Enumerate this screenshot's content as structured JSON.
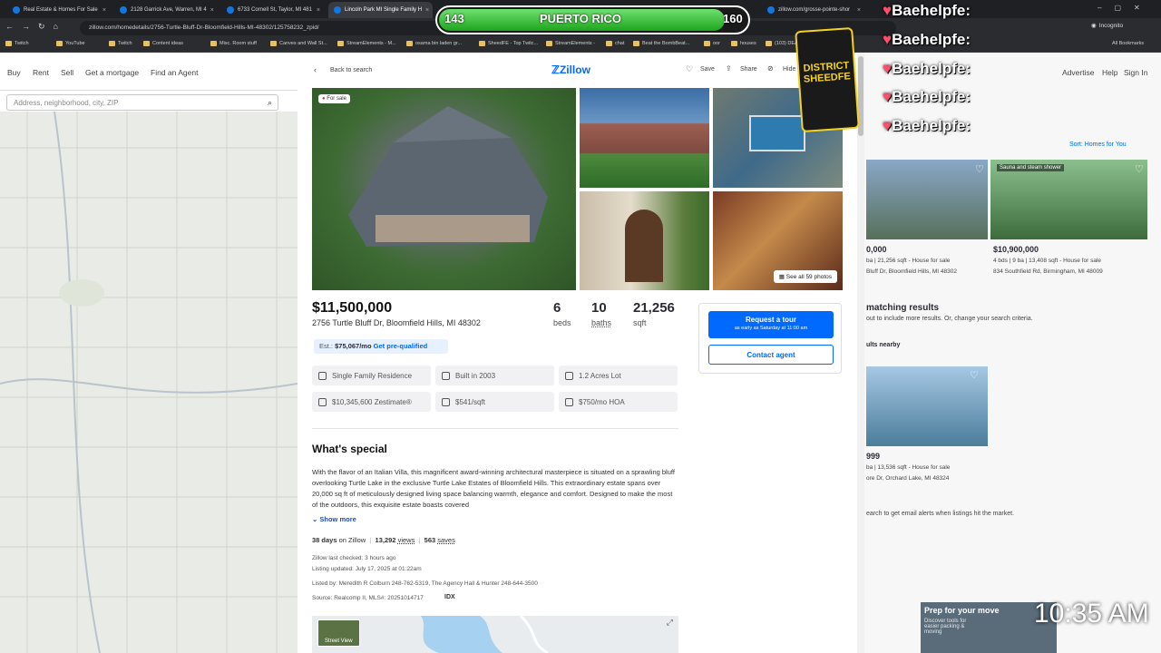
{
  "browser": {
    "tabs": [
      {
        "label": "Real Estate & Homes For Sale",
        "active": false
      },
      {
        "label": "2128 Garrick Ave, Warren, MI 4",
        "active": false
      },
      {
        "label": "6733 Cornell St, Taylor, MI 481",
        "active": false
      },
      {
        "label": "Lincoln Park MI Single Family H",
        "active": false
      },
      {
        "label": "zillow.com/grosse-pointe-shor",
        "active": false
      }
    ],
    "url": "zillow.com/homedetails/2756-Turtle-Bluff-Dr-Bloomfield-Hills-MI-48302/125758232_zpid/",
    "incognito": "Incognito",
    "bookmarks": [
      "Twitch",
      "YouTube",
      "Twitch",
      "Content ideas",
      "Misc. Room stuff",
      "Canves and Wall St...",
      "StreamElements - M...",
      "osama bin laden gr...",
      "SheedFE - Top Twitc...",
      "StreamElements -",
      "chat",
      "Beat the BombBeat...",
      "oor",
      "houses",
      "(103) DEA"
    ],
    "all_bookmarks": "All Bookmarks"
  },
  "zillow_nav": {
    "items": [
      "Buy",
      "Rent",
      "Sell",
      "Get a mortgage",
      "Find an Agent"
    ],
    "right_items": [
      "Advertise",
      "Help",
      "Sign In"
    ],
    "search_placeholder": "Address, neighborhood, city, ZIP"
  },
  "listing": {
    "back_label": "Back to search",
    "brand": "Zillow",
    "save_label": "Save",
    "share_label": "Share",
    "hide_label": "Hide",
    "for_sale_badge": "For sale",
    "see_all_photos": "See all 59 photos",
    "price": "$11,500,000",
    "address": "2756 Turtle Bluff Dr, Bloomfield Hills, MI 48302",
    "beds": "6",
    "beds_label": "beds",
    "baths": "10",
    "baths_label": "baths",
    "sqft": "21,256",
    "sqft_label": "sqft",
    "est_prefix": "Est.:",
    "est_value": "$75,067/mo",
    "prequal": "Get pre-qualified",
    "facts": [
      "Single Family Residence",
      "Built in 2003",
      "1.2 Acres Lot",
      "$10,345,600 Zestimate®",
      "$541/sqft",
      "$750/mo HOA"
    ],
    "tour_label": "Request a tour",
    "tour_sub": "as early as Saturday at 11:00 am",
    "contact_label": "Contact agent",
    "special_heading": "What's special",
    "description": "With the flavor of an Italian Villa, this magnificent award-winning architectural masterpiece is situated on a sprawling bluff overlooking Turtle Lake in the exclusive Turtle Lake Estates of Bloomfield Hills. This extraordinary estate spans over 20,000 sq ft of meticulously designed living space balancing warmth, elegance and comfort. Designed to make the most of the outdoors, this exquisite estate boasts covered",
    "show_more": "Show more",
    "days": "38 days",
    "days_suffix": "on Zillow",
    "views": "13,292",
    "views_label": "views",
    "saves": "563",
    "saves_label": "saves",
    "last_checked": "Zillow last checked: 3 hours ago",
    "updated": "Listing updated: July 17, 2025 at 01:22am",
    "listed_by": "Listed by: Meredith R Colburn 248-762-5319, The Agency Hall & Hunter 248-644-3500",
    "source": "Source: Realcomp II, MLS#: 20251014717",
    "idx": "IDX",
    "street_view": "Street View"
  },
  "right_panel": {
    "sort": "Sort: Homes for You",
    "card1_price": "0,000",
    "card1_details": "ba | 21,256 sqft - House for sale",
    "card1_address": "Bluff Dr, Bloomfield Hills, MI 48302",
    "card2_tag": "Sauna and steam shower",
    "card2_price": "$10,900,000",
    "card2_details": "4 bds | 9 ba | 13,408 sqft - House for sale",
    "card2_address": "834 Southfield Rd, Birmingham, MI 48009",
    "matching": "matching results",
    "matching_sub": "out to include more results. Or, change your search criteria.",
    "nearby": "ults nearby",
    "card3_price": "999",
    "card3_details": "ba | 13,536 sqft - House for sale",
    "card3_address": "ore Dr, Orchard Lake, MI 48324",
    "alerts": "earch to get email alerts when listings hit the market.",
    "prep_title": "Prep for your move",
    "prep_sub": "Discover tools for easier packing & moving"
  },
  "overlay": {
    "score_left": "143",
    "score_title": "PUERTO RICO",
    "score_right": "160",
    "chat_name": "Baehelpfe:",
    "chat_lines": 5,
    "logo": "DISTRICT SHEEDFE",
    "clock": "10:35 AM"
  },
  "colors": {
    "accent": "#006aff",
    "score_green": "#1ea51e"
  }
}
